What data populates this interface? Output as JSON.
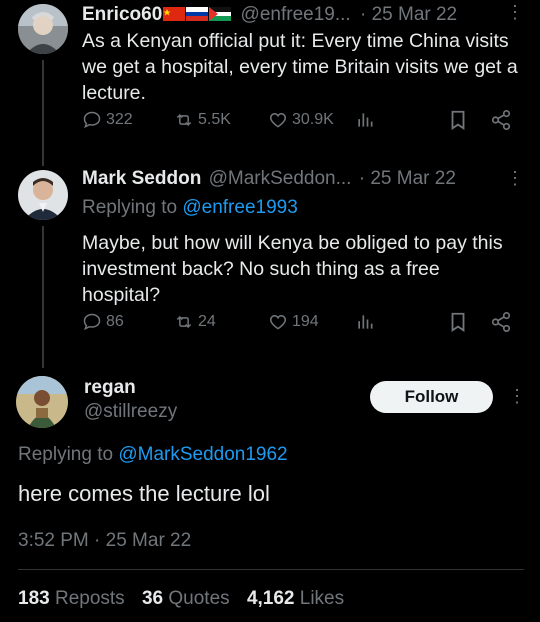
{
  "tweet1": {
    "name": "Enrico60",
    "handle": "@enfree19...",
    "date": "· 25 Mar 22",
    "text": "As a Kenyan official put it: Every time China visits we get a hospital, every time Britain visits we get a lecture.",
    "replies": "322",
    "reposts": "5.5K",
    "likes": "30.9K"
  },
  "tweet2": {
    "name": "Mark Seddon",
    "handle": "@MarkSeddon...",
    "date": "· 25 Mar 22",
    "replying_prefix": "Replying to",
    "replying_to": "@enfree1993",
    "text": "Maybe, but how will Kenya be obliged to pay this investment back? No such thing as a free hospital?",
    "replies": "86",
    "reposts": "24",
    "likes": "194"
  },
  "main_tweet": {
    "name": "regan",
    "handle": "@stillreezy",
    "follow_label": "Follow",
    "replying_prefix": "Replying to",
    "replying_to": "@MarkSeddon1962",
    "text": "here comes the lecture lol",
    "timestamp": "3:52 PM · 25 Mar 22",
    "reposts_count": "183",
    "reposts_label": "Reposts",
    "quotes_count": "36",
    "quotes_label": "Quotes",
    "likes_count": "4,162",
    "likes_label": "Likes"
  },
  "icons": {
    "reply": "reply-icon",
    "repost": "repost-icon",
    "like": "heart-icon",
    "views": "views-icon",
    "bookmark": "bookmark-icon",
    "share": "share-icon",
    "more": "more-icon"
  },
  "colors": {
    "background": "#000000",
    "text": "#e7e9ea",
    "muted": "#71767b",
    "link": "#1d9bf0",
    "follow_bg": "#eff3f4"
  }
}
